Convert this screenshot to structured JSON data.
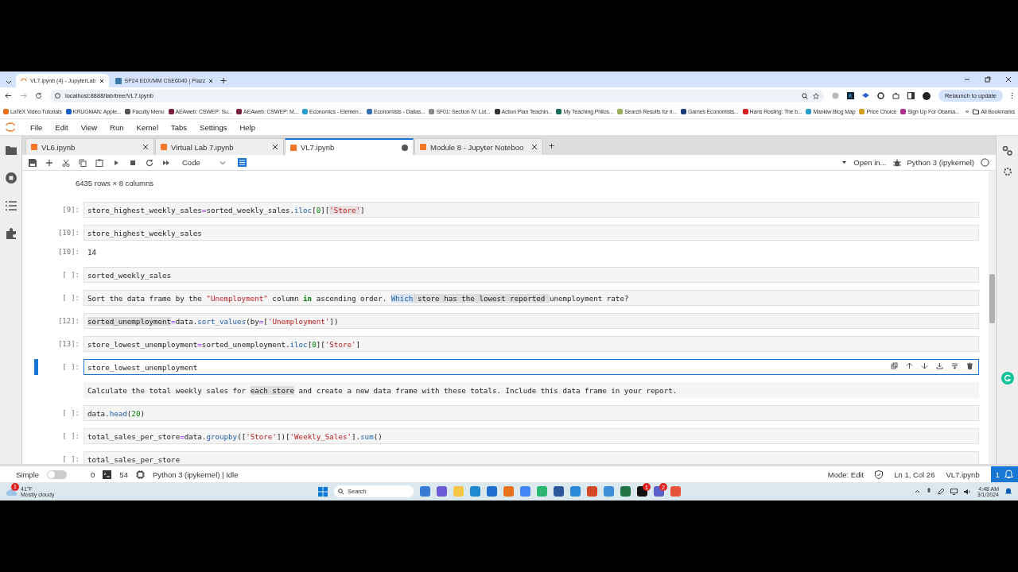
{
  "browser": {
    "tabs": [
      {
        "title": "VL7.ipynb (4) - JupyterLab",
        "selected": true
      },
      {
        "title": "SP24 EDX/MM CSE6040 | Piazz",
        "selected": false
      }
    ],
    "url": "localhost:8888/lab/tree/VL7.ipynb",
    "relaunch": "Relaunch to update",
    "bookmarks": [
      {
        "label": "LaTeX Video Tutorials",
        "color": "#e8711c"
      },
      {
        "label": "KRUGMAN: Apple...",
        "color": "#1a5fc4"
      },
      {
        "label": "Faculty Menu",
        "color": "#555555"
      },
      {
        "label": "AEAweb: CSWEP: Su...",
        "color": "#7a1f3d"
      },
      {
        "label": "AEAweb: CSWEP: M...",
        "color": "#7a1f3d"
      },
      {
        "label": "Economics - Elemen...",
        "color": "#2aa0c8"
      },
      {
        "label": "Economists - Dallas...",
        "color": "#3a6fb0"
      },
      {
        "label": "SF01: Section IV: Lot...",
        "color": "#888888"
      },
      {
        "label": "Action Plan Teachin...",
        "color": "#333333"
      },
      {
        "label": "My Teaching Philos...",
        "color": "#1b6b5a"
      },
      {
        "label": "Search Results for ri...",
        "color": "#9aae5a"
      },
      {
        "label": "Games Economists...",
        "color": "#1c3f7a"
      },
      {
        "label": "Hans Rosling: The b...",
        "color": "#d42020"
      },
      {
        "label": "Mankiw Blog Map",
        "color": "#2aa0c8"
      },
      {
        "label": "Price Choice",
        "color": "#d0a020"
      },
      {
        "label": "Sign Up For Obama...",
        "color": "#b0308a"
      }
    ],
    "more": "»",
    "all_bookmarks": "All Bookmarks"
  },
  "jupyter": {
    "menu": [
      "File",
      "Edit",
      "View",
      "Run",
      "Kernel",
      "Tabs",
      "Settings",
      "Help"
    ],
    "new_tab": "+",
    "doc_tabs": [
      {
        "title": "VL6.ipynb",
        "selected": false,
        "unsaved": false
      },
      {
        "title": "Virtual Lab 7.ipynb",
        "selected": false,
        "unsaved": false
      },
      {
        "title": "VL7.ipynb",
        "selected": true,
        "unsaved": true
      },
      {
        "title": "Module 8 - Jupyter Noteboo",
        "selected": false,
        "unsaved": false
      }
    ],
    "toolbar": {
      "cell_type": "Code",
      "open_in": "Open in...",
      "kernel": "Python 3 (ipykernel)"
    },
    "output_summary": "6435 rows × 8 columns",
    "cells": [
      {
        "kind": "code",
        "prompt": "[9]:",
        "selected": false,
        "segments": [
          {
            "text": "store_highest_weekly_sales",
            "kind": "t"
          },
          {
            "text": "=",
            "kind": "op"
          },
          {
            "text": "sorted_weekly_sales.",
            "kind": "t"
          },
          {
            "text": "iloc",
            "kind": "fn"
          },
          {
            "text": "[",
            "kind": "t"
          },
          {
            "text": "0",
            "kind": "num"
          },
          {
            "text": "][",
            "kind": "t"
          },
          {
            "text": "'Store'",
            "kind": "hlstr"
          },
          {
            "text": "]",
            "kind": "t"
          }
        ]
      },
      {
        "kind": "code",
        "prompt": "[10]:",
        "selected": false,
        "segments": [
          {
            "text": "store_highest_weekly_sales",
            "kind": "t"
          }
        ]
      },
      {
        "kind": "output",
        "prompt": "[10]:",
        "selected": false,
        "segments": [
          {
            "text": "14",
            "kind": "t"
          }
        ]
      },
      {
        "kind": "code",
        "prompt": "[ ]:",
        "selected": false,
        "segments": [
          {
            "text": "sorted_weekly_sales",
            "kind": "t"
          }
        ]
      },
      {
        "kind": "code",
        "prompt": "[ ]:",
        "selected": false,
        "segments": [
          {
            "text": "Sort the data frame by the ",
            "kind": "t"
          },
          {
            "text": "\"Unemployment\"",
            "kind": "str"
          },
          {
            "text": " column ",
            "kind": "t"
          },
          {
            "text": "in",
            "kind": "kw"
          },
          {
            "text": " ascending order. ",
            "kind": "t"
          },
          {
            "text": "Which",
            "kind": "hlfn"
          },
          {
            "text": " store has the lowest reported ",
            "kind": "hl"
          },
          {
            "text": "unemployment rate?",
            "kind": "t"
          }
        ]
      },
      {
        "kind": "code",
        "prompt": "[12]:",
        "selected": false,
        "segments": [
          {
            "text": "sorted_unemployment",
            "kind": "hl"
          },
          {
            "text": "=",
            "kind": "op"
          },
          {
            "text": "data.",
            "kind": "t"
          },
          {
            "text": "sort_values",
            "kind": "fn"
          },
          {
            "text": "(by",
            "kind": "t"
          },
          {
            "text": "=",
            "kind": "op"
          },
          {
            "text": "[",
            "kind": "t"
          },
          {
            "text": "'Unemployment'",
            "kind": "str"
          },
          {
            "text": "])",
            "kind": "t"
          }
        ]
      },
      {
        "kind": "code",
        "prompt": "[13]:",
        "selected": false,
        "segments": [
          {
            "text": "store_lowest_unemployment",
            "kind": "t"
          },
          {
            "text": "=",
            "kind": "op"
          },
          {
            "text": "sorted_unemployment.",
            "kind": "t"
          },
          {
            "text": "iloc",
            "kind": "fn"
          },
          {
            "text": "[",
            "kind": "t"
          },
          {
            "text": "0",
            "kind": "num"
          },
          {
            "text": "][",
            "kind": "t"
          },
          {
            "text": "'Store'",
            "kind": "str"
          },
          {
            "text": "]",
            "kind": "t"
          }
        ]
      },
      {
        "kind": "code",
        "prompt": "[ ]:",
        "selected": true,
        "segments": [
          {
            "text": "store_lowest_unemployment",
            "kind": "t"
          }
        ]
      },
      {
        "kind": "markdown",
        "selected": false,
        "segments": [
          {
            "text": "Calculate the total weekly sales for ",
            "kind": "t"
          },
          {
            "text": "each store",
            "kind": "hl"
          },
          {
            "text": " and create a new data frame with these totals. Include this data frame in your report.",
            "kind": "t"
          }
        ]
      },
      {
        "kind": "code",
        "prompt": "[ ]:",
        "selected": false,
        "segments": [
          {
            "text": "data.",
            "kind": "t"
          },
          {
            "text": "head",
            "kind": "fn"
          },
          {
            "text": "(",
            "kind": "t"
          },
          {
            "text": "20",
            "kind": "num"
          },
          {
            "text": ")",
            "kind": "t"
          }
        ]
      },
      {
        "kind": "code",
        "prompt": "[ ]:",
        "selected": false,
        "segments": [
          {
            "text": "total_sales_per_store",
            "kind": "t"
          },
          {
            "text": "=",
            "kind": "op"
          },
          {
            "text": "data.",
            "kind": "t"
          },
          {
            "text": "groupby",
            "kind": "fn"
          },
          {
            "text": "([",
            "kind": "t"
          },
          {
            "text": "'Store'",
            "kind": "str"
          },
          {
            "text": "])[",
            "kind": "t"
          },
          {
            "text": "'Weekly_Sales'",
            "kind": "str"
          },
          {
            "text": "].",
            "kind": "t"
          },
          {
            "text": "sum",
            "kind": "fn"
          },
          {
            "text": "()",
            "kind": "t"
          }
        ]
      },
      {
        "kind": "code",
        "prompt": "[ ]:",
        "selected": false,
        "segments": [
          {
            "text": "total_sales_per_store",
            "kind": "t"
          }
        ]
      }
    ],
    "status": {
      "simple_label": "Simple",
      "simple_on": false,
      "terminals": "0",
      "kernels": "54",
      "kernel_status": "Python 3 (ipykernel) | Idle",
      "mode": "Mode: Edit",
      "position": "Ln 1, Col 26",
      "file": "VL7.ipynb",
      "notifications": "1"
    }
  },
  "taskbar": {
    "weather_badge": "1",
    "temperature": "41°F",
    "weather": "Mostly cloudy",
    "search": "Search",
    "apps": [
      {
        "color": "#3a7bd5"
      },
      {
        "color": "#6b5bd6"
      },
      {
        "color": "#f2c744"
      },
      {
        "color": "#1e88d0"
      },
      {
        "color": "#1f6fd0"
      },
      {
        "color": "#e8711c"
      },
      {
        "color": "#4285f4"
      },
      {
        "color": "#2bb673"
      },
      {
        "color": "#2b579a"
      },
      {
        "color": "#2a8ad8"
      },
      {
        "color": "#d24726"
      },
      {
        "color": "#3a8fd8"
      },
      {
        "color": "#217346"
      },
      {
        "color": "#111111",
        "badge": "1"
      },
      {
        "color": "#5b5fc7",
        "badge": "2"
      },
      {
        "color": "#e8543a"
      }
    ],
    "time": "4:48 AM",
    "date": "3/1/2024"
  }
}
